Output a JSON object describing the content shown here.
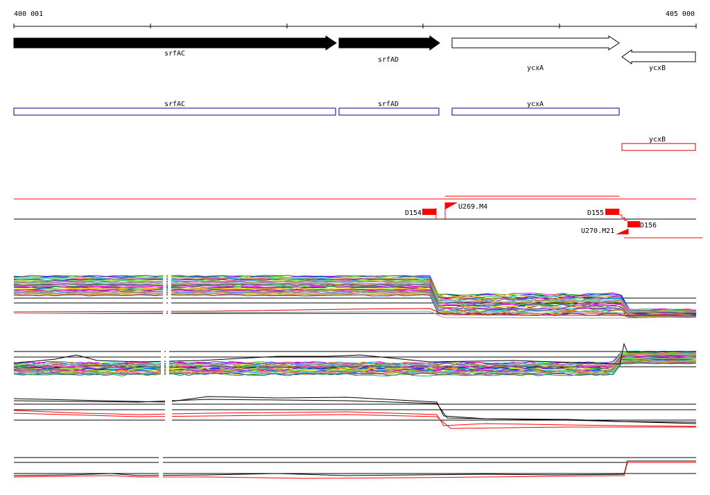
{
  "ruler": {
    "start_label": "400 001",
    "end_label": "405 000"
  },
  "genes": [
    {
      "id": "srfAC",
      "label": "srfAC",
      "strand": "+",
      "filled": true
    },
    {
      "id": "srfAD",
      "label": "srfAD",
      "strand": "+",
      "filled": true
    },
    {
      "id": "ycxA",
      "label": "ycxA",
      "strand": "+",
      "filled": false
    },
    {
      "id": "ycxB",
      "label": "ycxB",
      "strand": "-",
      "filled": false
    }
  ],
  "annotations": [
    {
      "label": "srfAC",
      "color": "#00008b"
    },
    {
      "label": "srfAD",
      "color": "#00008b"
    },
    {
      "label": "ycxA",
      "color": "#00008b"
    },
    {
      "label": "ycxB",
      "color": "#cc0000"
    }
  ],
  "features": [
    {
      "label": "D154",
      "type": "block"
    },
    {
      "label": "U269.M4",
      "type": "flag"
    },
    {
      "label": "D155",
      "type": "block"
    },
    {
      "label": "D156",
      "type": "block"
    },
    {
      "label": "U270.M21",
      "type": "flag"
    }
  ],
  "colors": {
    "feature": "#ff0000",
    "plus_strand": "#0000ff",
    "antisense": "#cc0000",
    "outline": "#00008b"
  }
}
